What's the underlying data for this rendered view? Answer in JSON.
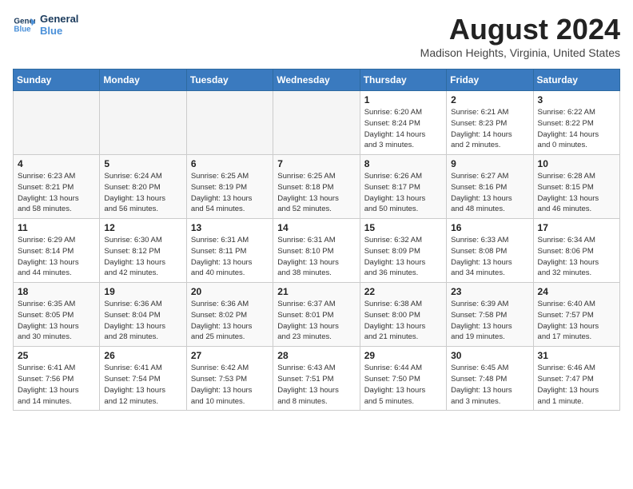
{
  "header": {
    "logo_line1": "General",
    "logo_line2": "Blue",
    "month_title": "August 2024",
    "location": "Madison Heights, Virginia, United States"
  },
  "days_of_week": [
    "Sunday",
    "Monday",
    "Tuesday",
    "Wednesday",
    "Thursday",
    "Friday",
    "Saturday"
  ],
  "weeks": [
    [
      {
        "day": "",
        "info": ""
      },
      {
        "day": "",
        "info": ""
      },
      {
        "day": "",
        "info": ""
      },
      {
        "day": "",
        "info": ""
      },
      {
        "day": "1",
        "info": "Sunrise: 6:20 AM\nSunset: 8:24 PM\nDaylight: 14 hours\nand 3 minutes."
      },
      {
        "day": "2",
        "info": "Sunrise: 6:21 AM\nSunset: 8:23 PM\nDaylight: 14 hours\nand 2 minutes."
      },
      {
        "day": "3",
        "info": "Sunrise: 6:22 AM\nSunset: 8:22 PM\nDaylight: 14 hours\nand 0 minutes."
      }
    ],
    [
      {
        "day": "4",
        "info": "Sunrise: 6:23 AM\nSunset: 8:21 PM\nDaylight: 13 hours\nand 58 minutes."
      },
      {
        "day": "5",
        "info": "Sunrise: 6:24 AM\nSunset: 8:20 PM\nDaylight: 13 hours\nand 56 minutes."
      },
      {
        "day": "6",
        "info": "Sunrise: 6:25 AM\nSunset: 8:19 PM\nDaylight: 13 hours\nand 54 minutes."
      },
      {
        "day": "7",
        "info": "Sunrise: 6:25 AM\nSunset: 8:18 PM\nDaylight: 13 hours\nand 52 minutes."
      },
      {
        "day": "8",
        "info": "Sunrise: 6:26 AM\nSunset: 8:17 PM\nDaylight: 13 hours\nand 50 minutes."
      },
      {
        "day": "9",
        "info": "Sunrise: 6:27 AM\nSunset: 8:16 PM\nDaylight: 13 hours\nand 48 minutes."
      },
      {
        "day": "10",
        "info": "Sunrise: 6:28 AM\nSunset: 8:15 PM\nDaylight: 13 hours\nand 46 minutes."
      }
    ],
    [
      {
        "day": "11",
        "info": "Sunrise: 6:29 AM\nSunset: 8:14 PM\nDaylight: 13 hours\nand 44 minutes."
      },
      {
        "day": "12",
        "info": "Sunrise: 6:30 AM\nSunset: 8:12 PM\nDaylight: 13 hours\nand 42 minutes."
      },
      {
        "day": "13",
        "info": "Sunrise: 6:31 AM\nSunset: 8:11 PM\nDaylight: 13 hours\nand 40 minutes."
      },
      {
        "day": "14",
        "info": "Sunrise: 6:31 AM\nSunset: 8:10 PM\nDaylight: 13 hours\nand 38 minutes."
      },
      {
        "day": "15",
        "info": "Sunrise: 6:32 AM\nSunset: 8:09 PM\nDaylight: 13 hours\nand 36 minutes."
      },
      {
        "day": "16",
        "info": "Sunrise: 6:33 AM\nSunset: 8:08 PM\nDaylight: 13 hours\nand 34 minutes."
      },
      {
        "day": "17",
        "info": "Sunrise: 6:34 AM\nSunset: 8:06 PM\nDaylight: 13 hours\nand 32 minutes."
      }
    ],
    [
      {
        "day": "18",
        "info": "Sunrise: 6:35 AM\nSunset: 8:05 PM\nDaylight: 13 hours\nand 30 minutes."
      },
      {
        "day": "19",
        "info": "Sunrise: 6:36 AM\nSunset: 8:04 PM\nDaylight: 13 hours\nand 28 minutes."
      },
      {
        "day": "20",
        "info": "Sunrise: 6:36 AM\nSunset: 8:02 PM\nDaylight: 13 hours\nand 25 minutes."
      },
      {
        "day": "21",
        "info": "Sunrise: 6:37 AM\nSunset: 8:01 PM\nDaylight: 13 hours\nand 23 minutes."
      },
      {
        "day": "22",
        "info": "Sunrise: 6:38 AM\nSunset: 8:00 PM\nDaylight: 13 hours\nand 21 minutes."
      },
      {
        "day": "23",
        "info": "Sunrise: 6:39 AM\nSunset: 7:58 PM\nDaylight: 13 hours\nand 19 minutes."
      },
      {
        "day": "24",
        "info": "Sunrise: 6:40 AM\nSunset: 7:57 PM\nDaylight: 13 hours\nand 17 minutes."
      }
    ],
    [
      {
        "day": "25",
        "info": "Sunrise: 6:41 AM\nSunset: 7:56 PM\nDaylight: 13 hours\nand 14 minutes."
      },
      {
        "day": "26",
        "info": "Sunrise: 6:41 AM\nSunset: 7:54 PM\nDaylight: 13 hours\nand 12 minutes."
      },
      {
        "day": "27",
        "info": "Sunrise: 6:42 AM\nSunset: 7:53 PM\nDaylight: 13 hours\nand 10 minutes."
      },
      {
        "day": "28",
        "info": "Sunrise: 6:43 AM\nSunset: 7:51 PM\nDaylight: 13 hours\nand 8 minutes."
      },
      {
        "day": "29",
        "info": "Sunrise: 6:44 AM\nSunset: 7:50 PM\nDaylight: 13 hours\nand 5 minutes."
      },
      {
        "day": "30",
        "info": "Sunrise: 6:45 AM\nSunset: 7:48 PM\nDaylight: 13 hours\nand 3 minutes."
      },
      {
        "day": "31",
        "info": "Sunrise: 6:46 AM\nSunset: 7:47 PM\nDaylight: 13 hours\nand 1 minute."
      }
    ]
  ]
}
